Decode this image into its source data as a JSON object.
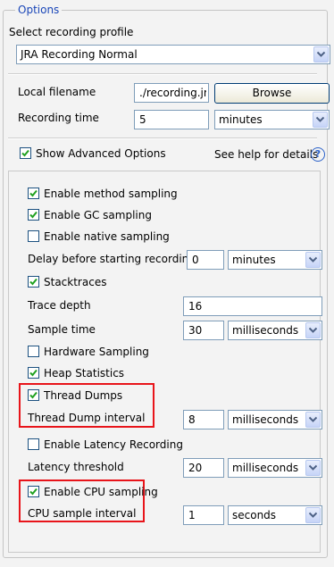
{
  "group_title": "Options",
  "profile": {
    "label": "Select recording profile",
    "value": "JRA Recording Normal"
  },
  "filename": {
    "label": "Local filename",
    "value": "./recording.jr",
    "browse_label": "Browse"
  },
  "recording_time": {
    "label": "Recording time",
    "value": "5",
    "unit": "minutes"
  },
  "advanced": {
    "label": "Show Advanced Options",
    "checked": true
  },
  "help": {
    "text": "See help for details",
    "icon": "help-circle-icon"
  },
  "options": {
    "method_sampling": "Enable method sampling",
    "gc_sampling": "Enable GC sampling",
    "native_sampling": "Enable native sampling",
    "delay_label": "Delay before starting recording",
    "delay_value": "0",
    "delay_unit": "minutes",
    "stacktraces": "Stacktraces",
    "trace_depth_label": "Trace depth",
    "trace_depth_value": "16",
    "sample_time_label": "Sample time",
    "sample_time_value": "30",
    "sample_time_unit": "milliseconds",
    "hardware_sampling": "Hardware Sampling",
    "heap_statistics": "Heap Statistics",
    "thread_dumps": "Thread Dumps",
    "thread_dump_interval_label": "Thread Dump interval",
    "thread_dump_interval_value": "8",
    "thread_dump_interval_unit": "milliseconds",
    "latency_recording": "Enable Latency Recording",
    "latency_threshold_label": "Latency threshold",
    "latency_threshold_value": "20",
    "latency_threshold_unit": "milliseconds",
    "cpu_sampling": "Enable CPU sampling",
    "cpu_interval_label": "CPU sample interval",
    "cpu_interval_value": "1",
    "cpu_interval_unit": "seconds"
  },
  "colors": {
    "highlight": "#e8141a",
    "legend": "#1a46b8",
    "field_border": "#7f9db9"
  }
}
